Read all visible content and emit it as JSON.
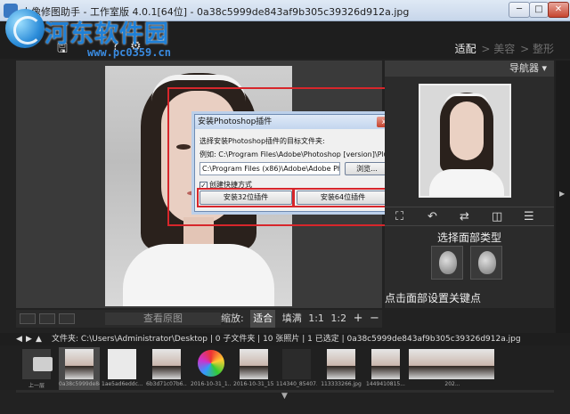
{
  "window": {
    "title": "人像修图助手 - 工作室版 4.0.1[64位] - 0a38c5999de843af9b305c39326d912a.jpg",
    "min_label": "─",
    "max_label": "□",
    "close_label": "✕"
  },
  "watermark": {
    "site_name": "河东软件园",
    "url": "www.pc0359.cn"
  },
  "toolbar": {
    "icons": [
      "save-icon",
      "help-icon",
      "gear-icon"
    ],
    "icon_glyphs": [
      "🖫",
      "?",
      "⚙"
    ]
  },
  "mode_tabs": [
    {
      "label": "适配",
      "active": true
    },
    {
      "label": "> 美容",
      "active": false
    },
    {
      "label": "> 整形",
      "active": false
    }
  ],
  "navigator": {
    "header": "导航器 ▾"
  },
  "side_tools": {
    "glyphs": [
      "⛶",
      "↶",
      "⇄",
      "◫",
      "☰"
    ]
  },
  "face_type": {
    "label": "选择面部类型"
  },
  "keypoint": {
    "label": "点击面部设置关键点"
  },
  "dialog": {
    "title": "安装Photoshop插件",
    "close": "x",
    "prompt": "选择安装Photoshop插件的目标文件夹:",
    "example": "例如: C:\\Program Files\\Adobe\\Photoshop [version]\\Plug-ins\\",
    "path_value": "C:\\Program Files (x86)\\Adobe\\Adobe Photos",
    "browse": "浏览...",
    "shortcut_label": "创建快捷方式",
    "shortcut_checked": "✓",
    "btn_32": "安装32位插件",
    "btn_64": "安装64位插件"
  },
  "viewbar": {
    "view_original": "查看原图"
  },
  "zoom": {
    "label": "缩放:",
    "fit": "适合",
    "fill": "填满",
    "one_to_one": "1:1",
    "one_to_two": "1:2",
    "plus": "+",
    "minus": "−"
  },
  "pathbar": {
    "nav_glyphs": [
      "◀",
      "▶",
      "▲"
    ],
    "text": "文件夹: C:\\Users\\Administrator\\Desktop | 0 子文件夹 | 10 张照片 | 1 已选定 | 0a38c5999de843af9b305c39326d912a.jpg"
  },
  "thumbnails": [
    {
      "caption": "上一层",
      "kind": "up"
    },
    {
      "caption": "0a38c5999de843af9b...",
      "kind": "port",
      "selected": true
    },
    {
      "caption": "1ae5ad6eddc...",
      "kind": "white"
    },
    {
      "caption": "6b3d71c07b6...",
      "kind": "port"
    },
    {
      "caption": "2016-10-31_1...",
      "kind": "pal"
    },
    {
      "caption": "2016-10-31_15...",
      "kind": "port"
    },
    {
      "caption": "114340_85407...",
      "kind": "dark"
    },
    {
      "caption": "113333266.jpg",
      "kind": "port"
    },
    {
      "caption": "1449410815...",
      "kind": "port"
    },
    {
      "caption": "202...",
      "kind": "wide"
    }
  ],
  "colors": {
    "accent_red": "#d7262b",
    "panel_bg": "#2b2b2b",
    "watermark_blue": "#1f80d6"
  }
}
